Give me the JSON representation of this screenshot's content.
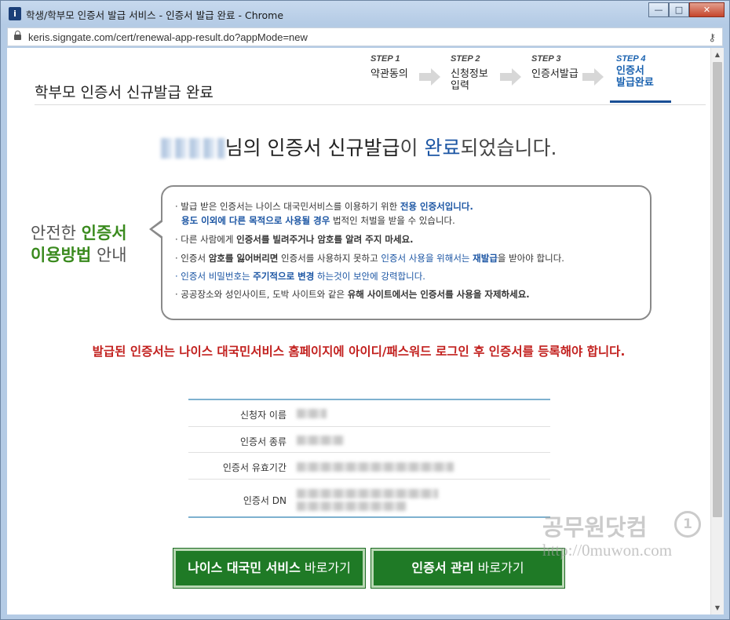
{
  "window": {
    "title": "학생/학부모 인증서 발급 서비스 - 인증서 발급 완료 - Chrome",
    "url": "keris.signgate.com/cert/renewal-app-result.do?appMode=new",
    "minimize_glyph": "—",
    "maximize_glyph": "□",
    "close_glyph": "✕"
  },
  "page": {
    "title": "학부모 인증서 신규발급 완료",
    "steps": [
      {
        "num": "STEP 1",
        "label": "약관동의"
      },
      {
        "num": "STEP 2",
        "label": "신청정보\n입력"
      },
      {
        "num": "STEP 3",
        "label": "인증서발급"
      },
      {
        "num": "STEP 4",
        "label": "인증서\n발급완료"
      }
    ],
    "active_step": 4,
    "headline": {
      "part1": "님의 인증서 신규발급",
      "part2": "이 ",
      "part3": "완료",
      "part4": "되었습니다."
    }
  },
  "guide": {
    "label_line1_a": "안전한 ",
    "label_line1_b": "인증서",
    "label_line2_a": "이용방법",
    "label_line2_b": " 안내",
    "notes": [
      {
        "a": "· 발급 받은 인증서는 나이스 대국민서비스를 이용하기 위한 ",
        "b": "전용 인증서입니다."
      },
      {
        "a": "  용도 이외에 다른 목적으로 사용될 경우",
        "b": " 법적인 처벌을 받을 수 있습니다."
      },
      {
        "a": "· 다른 사람에게 ",
        "b": "인증서를 빌려주거나 암호를 알려 주지 마세요.",
        "c": ""
      },
      {
        "a": "· 인증서 ",
        "b": "암호를 잃어버리면",
        "c": " 인증서를 사용하지 못하고 ",
        "d": "인증서 사용을 위해서는 ",
        "e": "재발급",
        "f": "을 받아야 합니다."
      },
      {
        "a": "· 인증서 비밀번호는 ",
        "b": "주기적으로 변경",
        "c": " 하는것이 보안에 강력합니다."
      },
      {
        "a": "· 공공장소와 성인사이트, 도박 사이트와 같은 ",
        "b": "유해 사이트에서는 인증서를 사용을 자제하세요."
      }
    ]
  },
  "warning": "발급된 인증서는 나이스 대국민서비스 홈페이지에 아이디/패스워드 로그인 후 인증서를 등록해야 합니다.",
  "info": {
    "rows": [
      {
        "label": "신청자 이름"
      },
      {
        "label": "인증서 종류"
      },
      {
        "label": "인증서 유효기간"
      },
      {
        "label": "인증서 DN"
      }
    ]
  },
  "buttons": {
    "neis_bold": "나이스 대국민 서비스",
    "neis_rest": " 바로가기",
    "cert_bold": "인증서 관리",
    "cert_rest": " 바로가기"
  },
  "watermark": {
    "text": "공무원닷컴",
    "badge": "1",
    "url": "http://0muwon.com"
  },
  "colors": {
    "accent_blue": "#1b55a3",
    "green": "#3a8a1e",
    "button_green": "#1f7a26",
    "warning_red": "#c2201e"
  }
}
